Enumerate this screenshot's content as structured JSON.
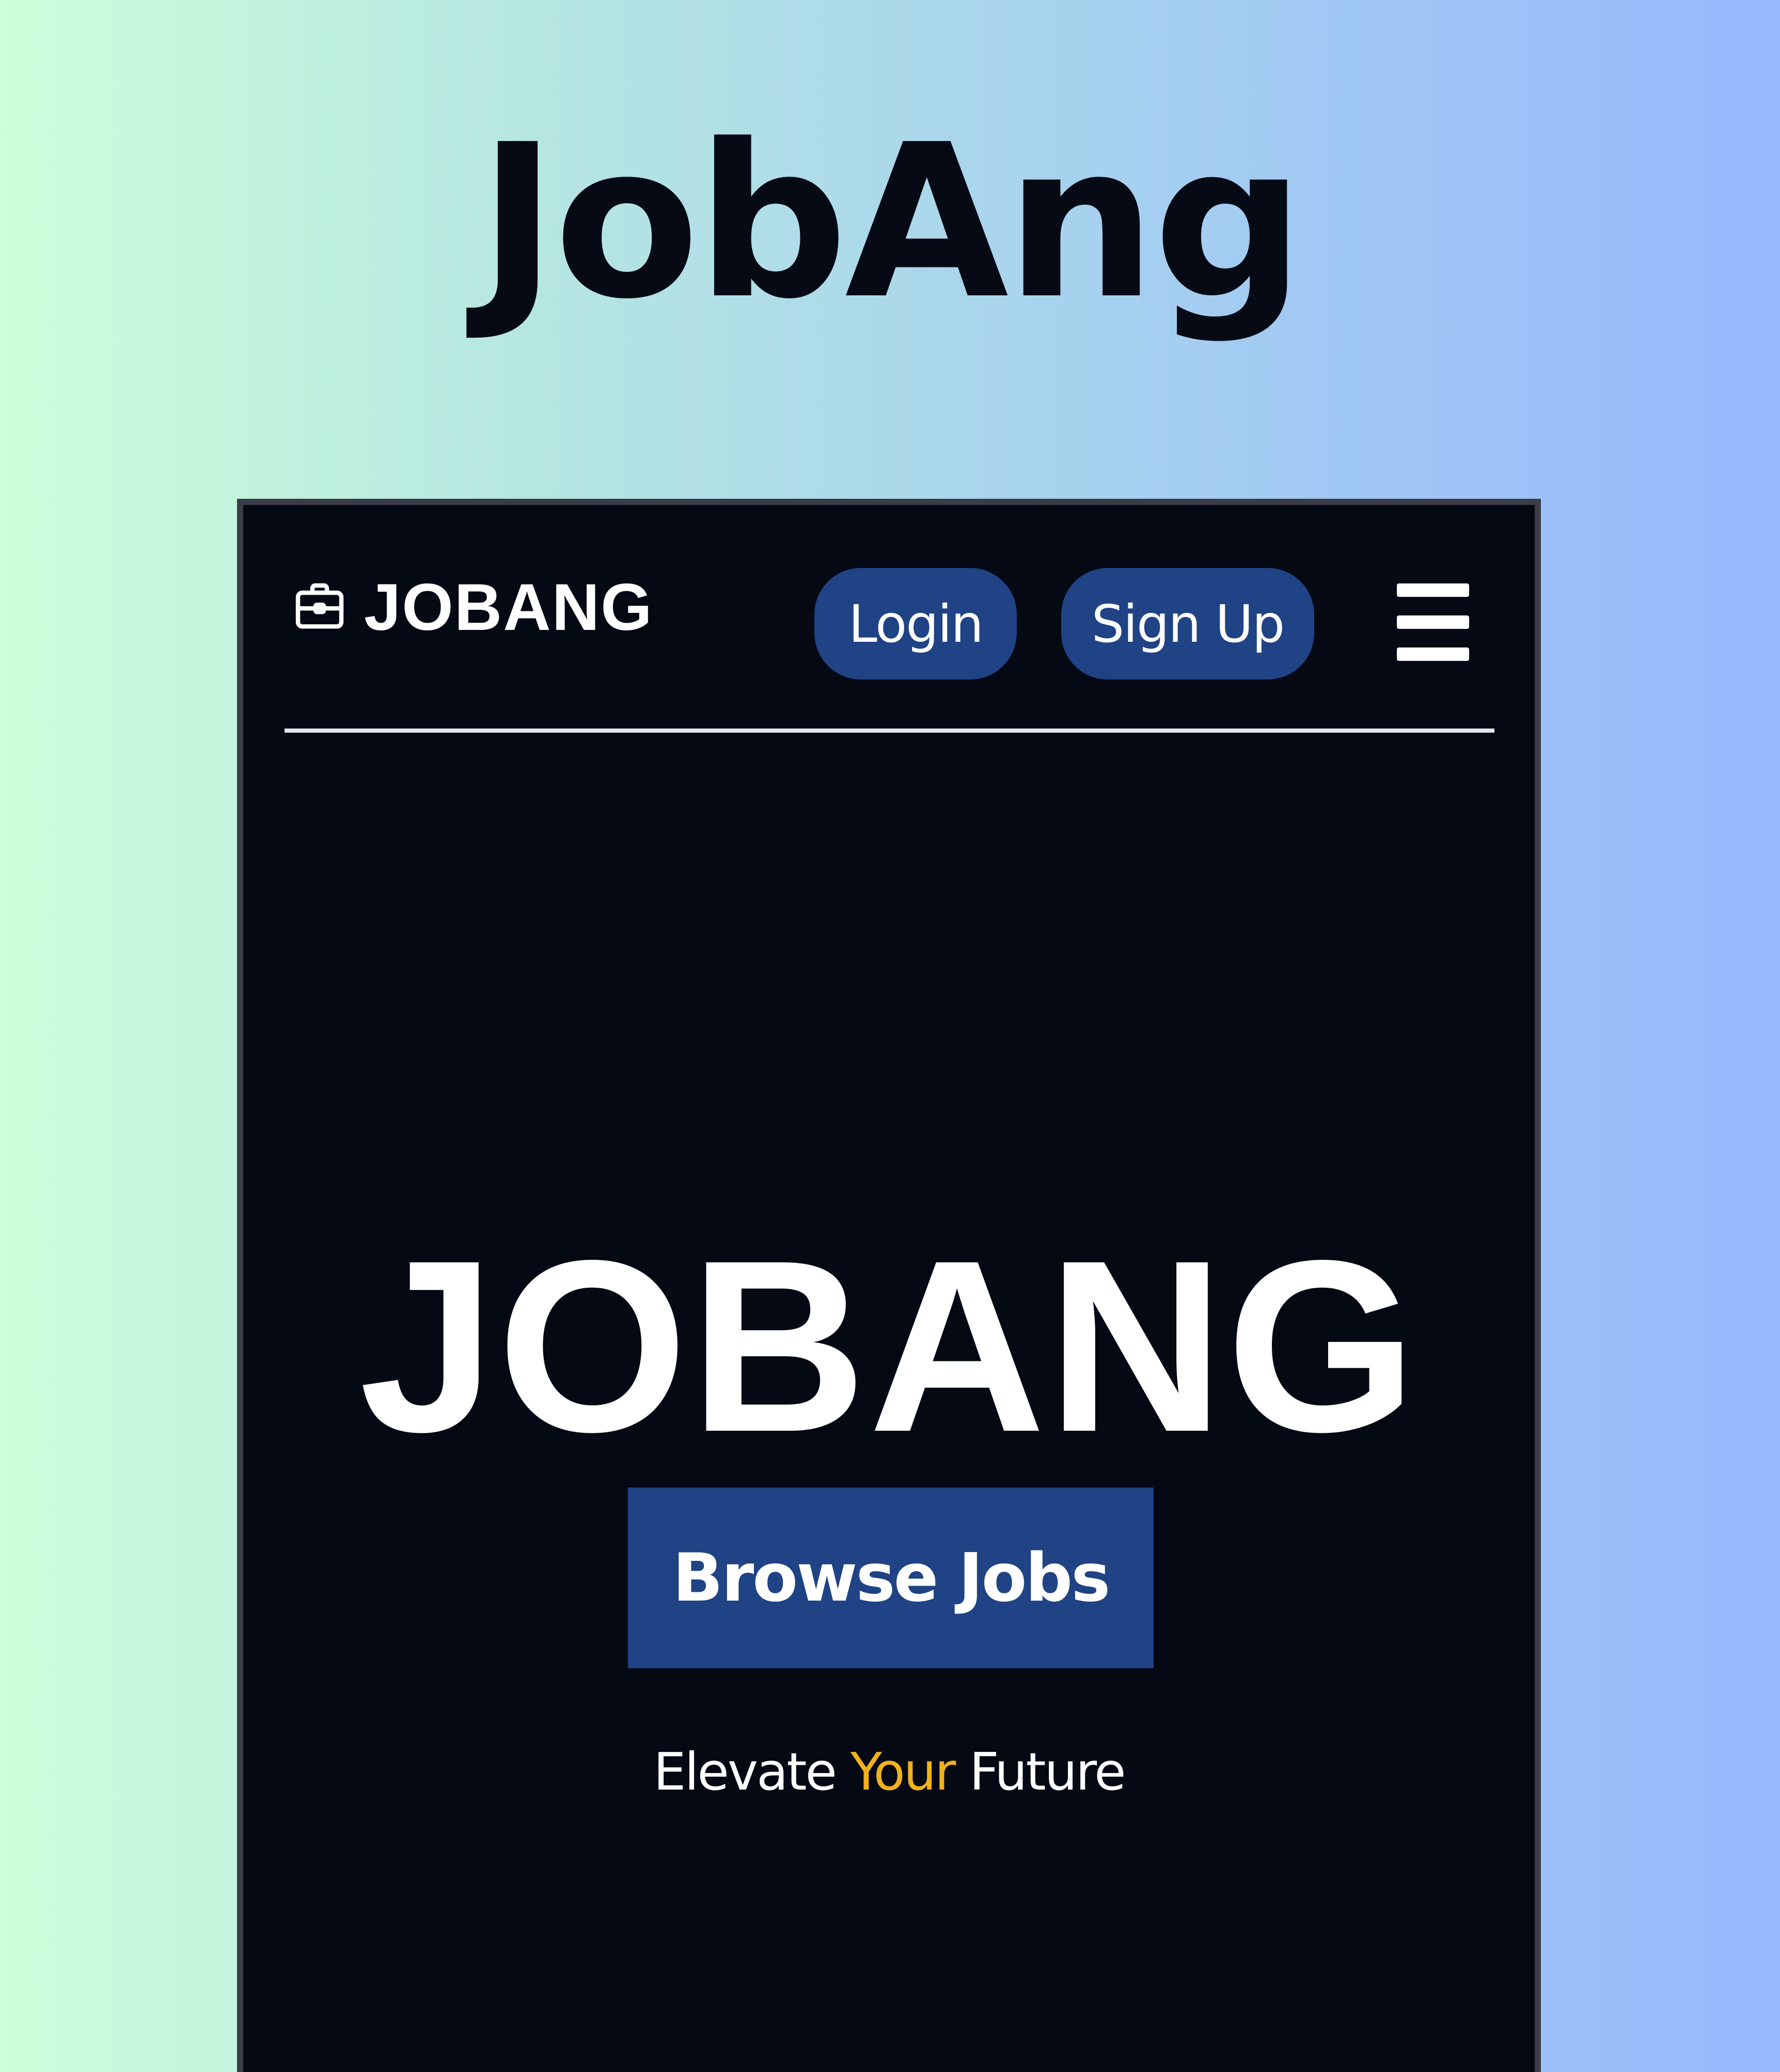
{
  "promo": {
    "title": "JobAng"
  },
  "navbar": {
    "brand_name": "JOBANG",
    "login_label": "Login",
    "signup_label": "Sign Up"
  },
  "hero": {
    "title": "JOBANG",
    "browse_label": "Browse Jobs",
    "tagline_prefix": "Elevate ",
    "tagline_accent": "Your",
    "tagline_suffix": " Future"
  },
  "icons": {
    "brand": "briefcase-icon",
    "menu": "hamburger-menu-icon"
  },
  "colors": {
    "background_left": "#ccffda",
    "background_right": "#96b8fe",
    "app_background": "#050914",
    "button_blue": "#1f4384",
    "accent_yellow": "#f0b21c",
    "text_white": "#ffffff",
    "title_dark": "#060a14"
  }
}
